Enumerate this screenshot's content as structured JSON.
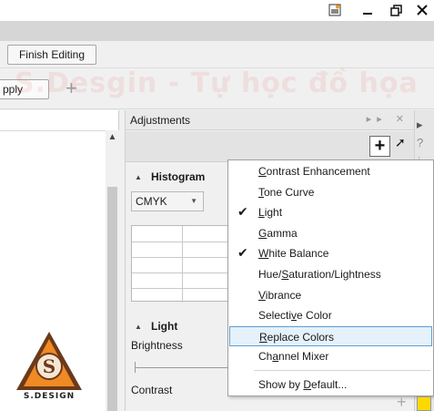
{
  "titlebar": {
    "controls": [
      {
        "name": "app-icon",
        "glyph": "🖼"
      },
      {
        "name": "minimize",
        "glyph": "▁"
      },
      {
        "name": "restore",
        "glyph": "❐"
      },
      {
        "name": "close",
        "glyph": "✕"
      }
    ]
  },
  "editing_bar": {
    "finish_label": "Finish Editing"
  },
  "toolbar": {
    "apply_label": "pply",
    "add_glyph": "+"
  },
  "watermark": {
    "text": "S.Desgin - Tự học đồ họa"
  },
  "logo": {
    "text": "S.DESIGN",
    "letter": "S",
    "colors": {
      "dark": "#6b3a1a",
      "orange": "#f08a24",
      "light": "#f6e7d4"
    }
  },
  "docker": {
    "title": "Adjustments",
    "head_icons": "▸▸ ✕",
    "add_glyph": "+",
    "histogram_section": {
      "title": "Histogram",
      "channel": "CMYK"
    },
    "light_section": {
      "title": "Light",
      "brightness_label": "Brightness",
      "contrast_label": "Contrast"
    }
  },
  "menu": {
    "items": [
      {
        "pre": "",
        "u": "C",
        "post": "ontrast Enhancement",
        "checked": false
      },
      {
        "pre": "",
        "u": "T",
        "post": "one Curve",
        "checked": false
      },
      {
        "pre": "",
        "u": "L",
        "post": "ight",
        "checked": true
      },
      {
        "pre": "",
        "u": "G",
        "post": "amma",
        "checked": false
      },
      {
        "pre": "",
        "u": "W",
        "post": "hite Balance",
        "checked": true
      },
      {
        "pre": "Hue/",
        "u": "S",
        "post": "aturation/Lightness",
        "checked": false
      },
      {
        "pre": "",
        "u": "V",
        "post": "ibrance",
        "checked": false
      },
      {
        "pre": "Selecti",
        "u": "v",
        "post": "e Color",
        "checked": false
      },
      {
        "pre": "",
        "u": "R",
        "post": "eplace Colors",
        "checked": false,
        "highlighted": true
      },
      {
        "pre": "Ch",
        "u": "a",
        "post": "nnel Mixer",
        "checked": false
      },
      {
        "pre": "Show by ",
        "u": "D",
        "post": "efault...",
        "checked": false,
        "separator_before": true
      }
    ]
  },
  "colors": {
    "highlight_bg": "#e5f1fb",
    "highlight_border": "#5d9fd6",
    "yellow_swatch": "#ffd800"
  }
}
